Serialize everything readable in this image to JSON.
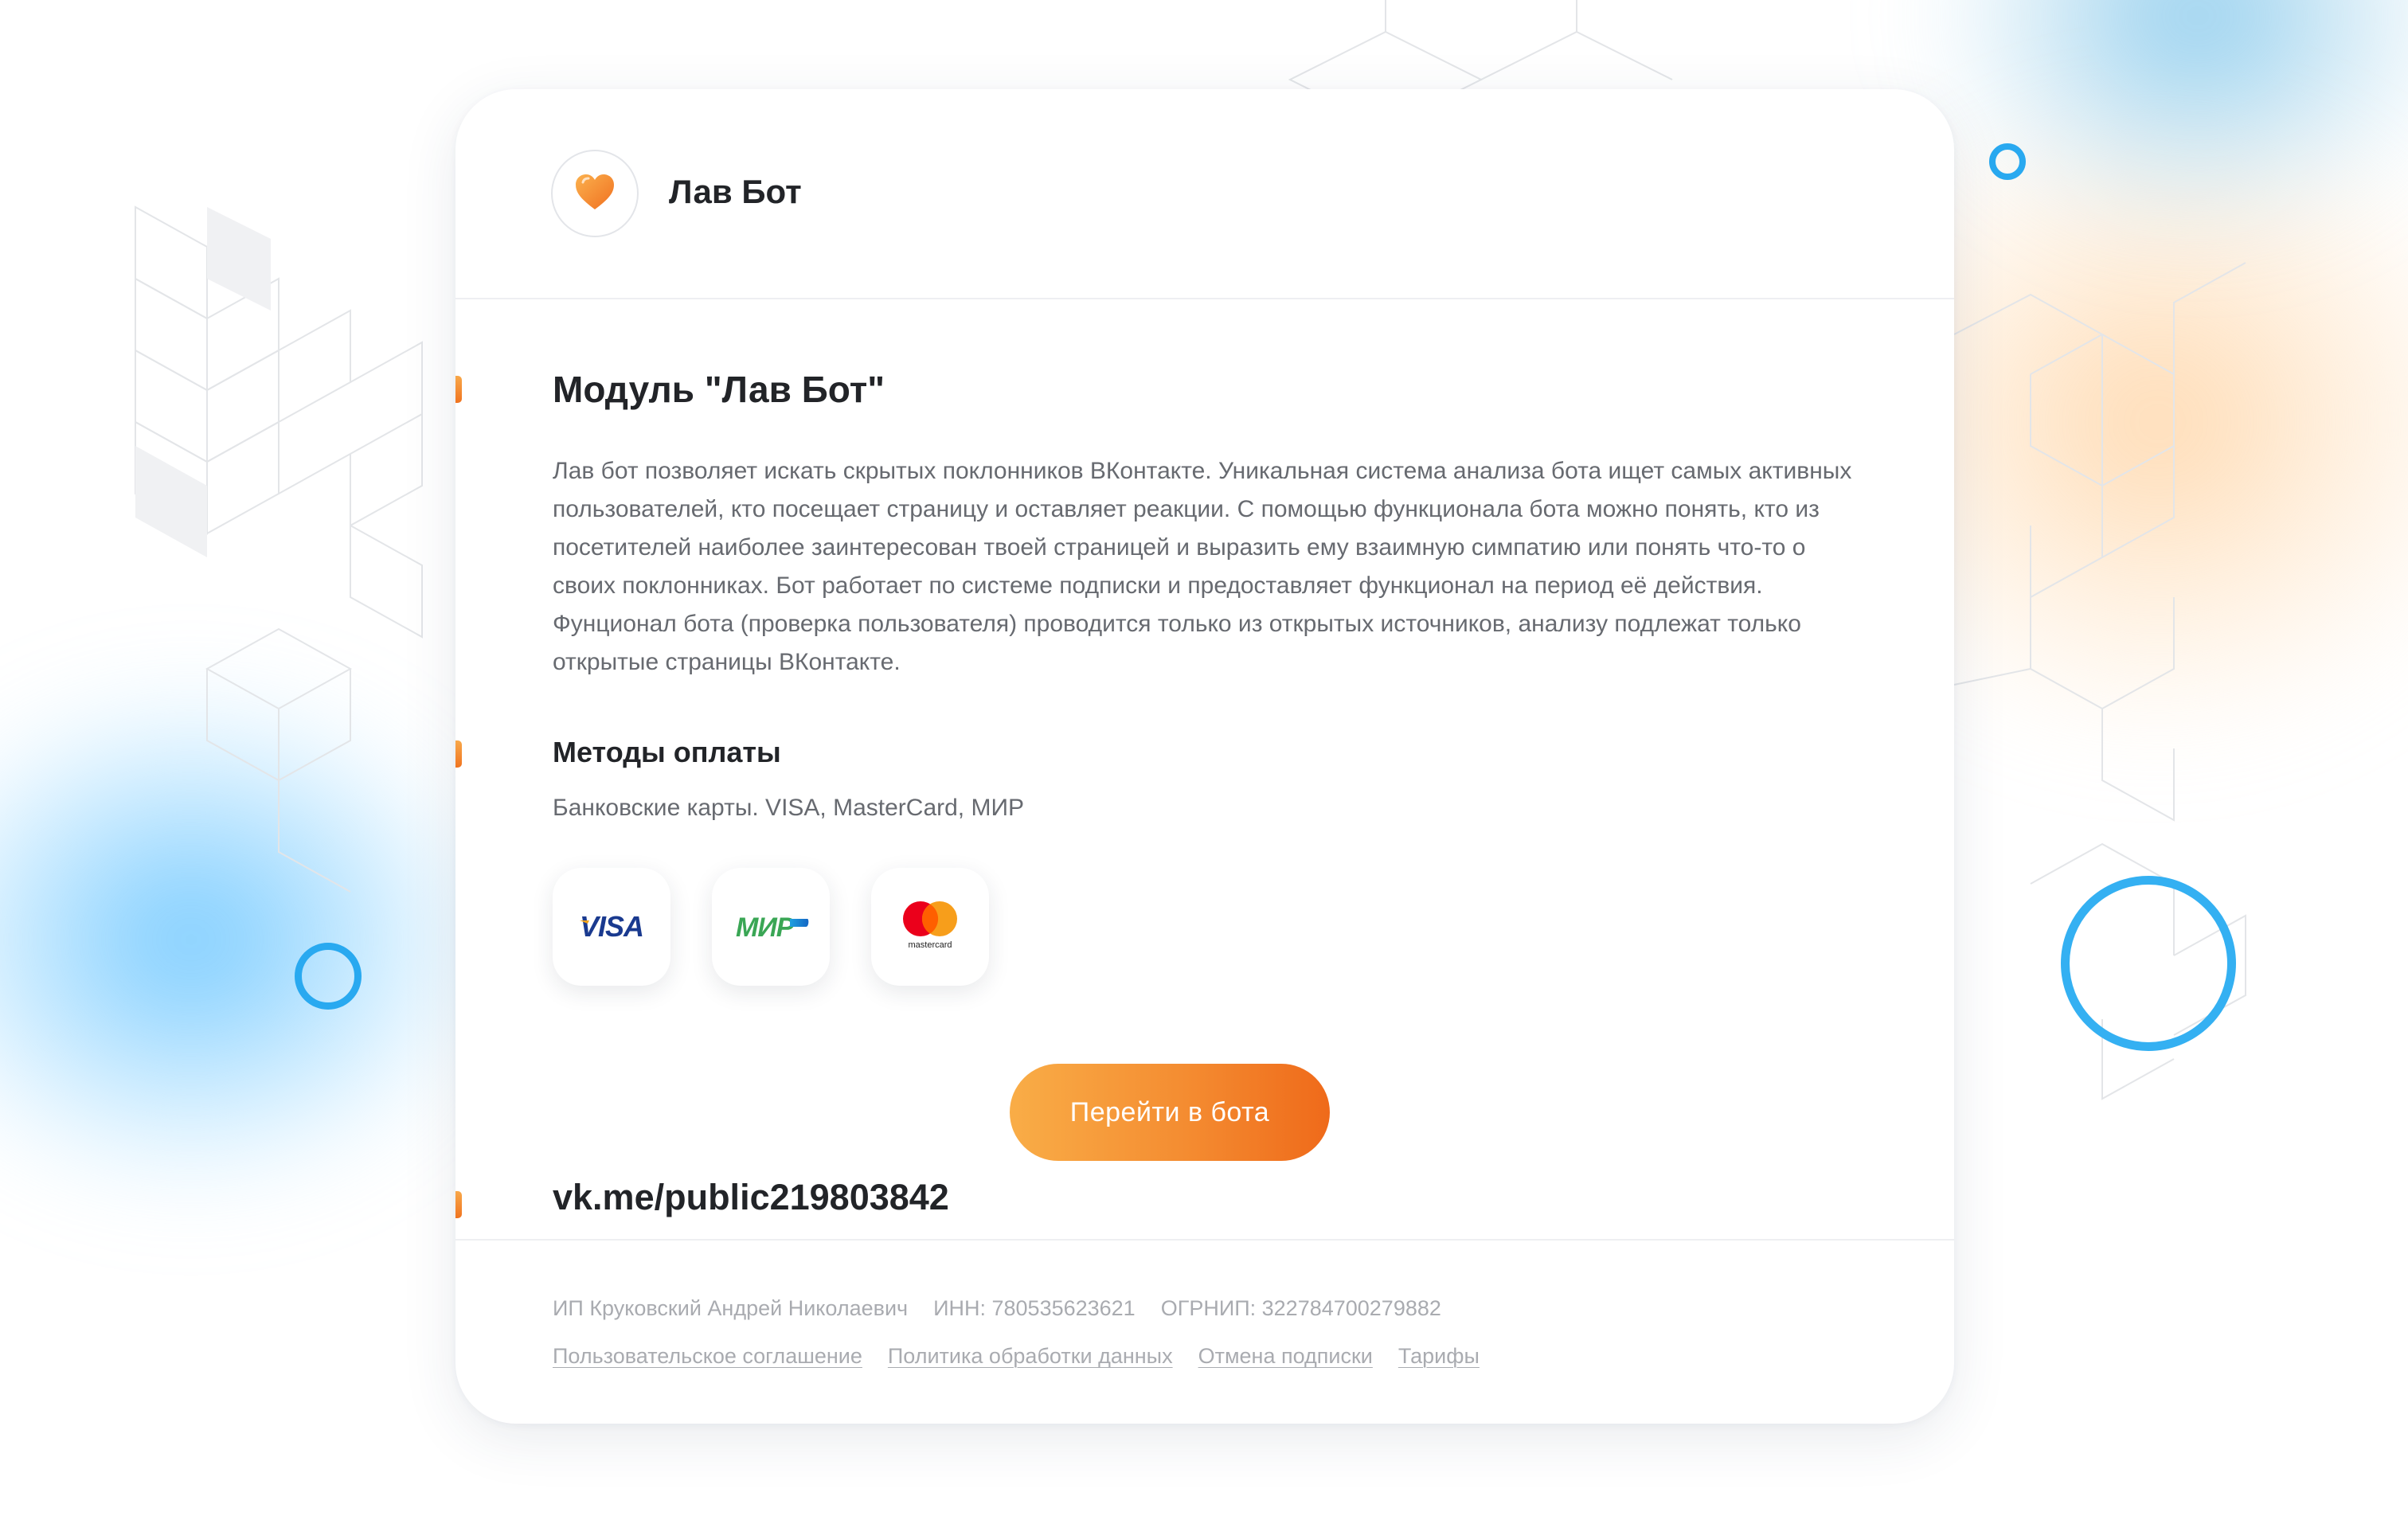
{
  "brand": {
    "name": "Лав Бот",
    "logo_icon": "heart-icon"
  },
  "module": {
    "title": "Модуль \"Лав Бот\"",
    "description": "Лав бот позволяет искать скрытых поклонников ВКонтакте. Уникальная система анализа бота ищет самых активных пользователей, кто посещает страницу и оставляет реакции. С помощью функционала бота можно понять, кто из посетителей наиболее заинтересован твоей страницей и выразить ему взаимную симпатию или понять что-то о своих поклонниках. Бот работает по системе подписки и предоставляет функционал на период её действия. Фунционал бота (проверка пользователя) проводится только из открытых источников, анализу подлежат только открытые страницы ВКонтакте."
  },
  "payment": {
    "title": "Методы оплаты",
    "subtitle": "Банковские карты. VISA, MasterCard, МИР",
    "cards": {
      "visa": "VISA",
      "mir": "МИР",
      "mastercard": "mastercard"
    }
  },
  "bot": {
    "link": "vk.me/public219803842",
    "button_label": "Перейти в бота"
  },
  "footer": {
    "owner": "ИП Круковский Андрей Николаевич",
    "inn": "ИНН: 780535623621",
    "ogrnip": "ОГРНИП: 322784700279882",
    "links": {
      "agreement": "Пользовательское соглашение",
      "privacy": "Политика обработки данных",
      "cancel": "Отмена подписки",
      "tariffs": "Тарифы"
    }
  },
  "colors": {
    "accent_orange": "#f48c31",
    "accent_blue": "#29a9f0",
    "text_dark": "#222428",
    "text_muted": "#676a70"
  }
}
